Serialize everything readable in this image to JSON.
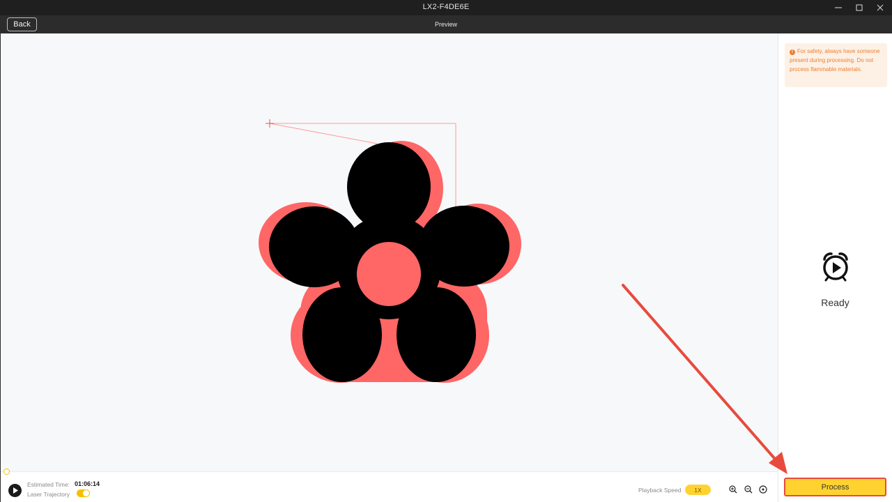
{
  "window": {
    "title": "LX2-F4DE6E",
    "controls": [
      "minimize-icon",
      "maximize-icon",
      "close-icon"
    ]
  },
  "header": {
    "back_label": "Back",
    "page_title": "Preview"
  },
  "canvas": {
    "design": "flower",
    "design_colors": {
      "shape_fill": "#000000",
      "offset_fill": "#ff6666",
      "center_fill": "#ff6666",
      "trajectory_line": "#ff9a9a",
      "origin_marker": "#e85050"
    }
  },
  "bottom_bar": {
    "estimated_time_label": "Estimated Time:",
    "estimated_time_value": "01:06:14",
    "laser_trajectory_label": "Laser Trajectory",
    "laser_trajectory_enabled": true,
    "playback_speed_label": "Playback Speed",
    "playback_speed_value": "1X",
    "zoom_icons": [
      "zoom-in-icon",
      "zoom-out-icon",
      "fit-view-icon"
    ]
  },
  "right_panel": {
    "warning_text": "For safety, always have someone present during processing. Do not process flammable materials.",
    "status_icon": "alarm-clock-play-icon",
    "status_text": "Ready",
    "process_label": "Process"
  },
  "colors": {
    "accent_yellow": "#ffd230",
    "warning_orange": "#ef7d2c",
    "annotation_red": "#e84a3e",
    "titlebar_bg": "#1f1f1f",
    "header_bg": "#2c2c2c"
  }
}
